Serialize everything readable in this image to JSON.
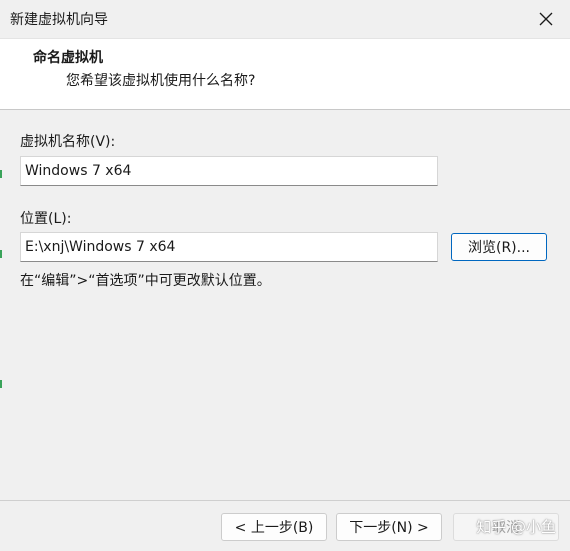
{
  "window": {
    "title": "新建虚拟机向导"
  },
  "header": {
    "title": "命名虚拟机",
    "subtitle": "您希望该虚拟机使用什么名称?"
  },
  "form": {
    "name_label": "虚拟机名称(V):",
    "name_value": "Windows 7 x64",
    "location_label": "位置(L):",
    "location_value": "E:\\xnj\\Windows 7 x64",
    "browse_label": "浏览(R)...",
    "hint": "在“编辑”>“首选项”中可更改默认位置。"
  },
  "footer": {
    "back_label": "< 上一步(B)",
    "next_label": "下一步(N) >",
    "cancel_label": "取消"
  },
  "watermark": "知乎 @小鱼",
  "icons": {
    "close": "close-icon"
  }
}
